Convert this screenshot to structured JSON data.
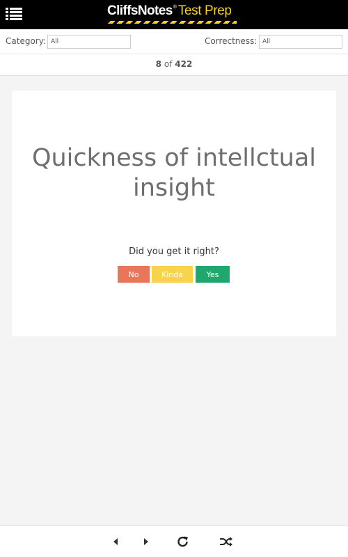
{
  "header": {
    "brand_main": "CliffsNotes",
    "brand_reg": "®",
    "brand_sub": "Test Prep",
    "menu_icon": "menu-list-icon"
  },
  "filters": {
    "category_label": "Category:",
    "category_value": "All",
    "correctness_label": "Correctness:",
    "correctness_value": "All"
  },
  "counter": {
    "current": "8",
    "of_text": "of",
    "total": "422"
  },
  "card": {
    "term": "Quickness of intellctual insight",
    "question": "Did you get it right?",
    "buttons": {
      "no": "No",
      "kinda": "Kinda",
      "yes": "Yes"
    }
  },
  "bottom_nav": {
    "icons": [
      "previous-icon",
      "next-icon",
      "refresh-icon",
      "shuffle-icon"
    ]
  },
  "colors": {
    "no": "#e8765a",
    "kinda": "#f7d44c",
    "yes": "#1fa76d",
    "brand_yellow": "#f5d21e"
  }
}
